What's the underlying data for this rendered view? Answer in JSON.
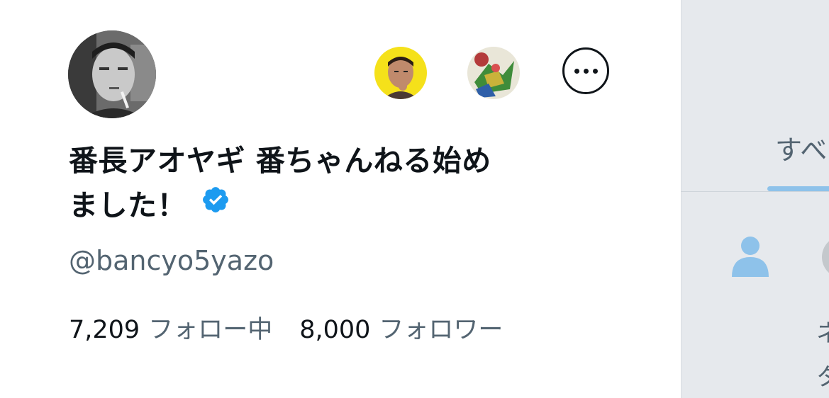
{
  "profile": {
    "display_name_line1": "番長アオヤギ 番ちゃんねる始め",
    "display_name_line2": "ました！",
    "handle": "@bancyo5yazo",
    "following_count": "7,209",
    "following_label": "フォロー中",
    "followers_count": "8,000",
    "followers_label": "フォロワー",
    "verified": true
  },
  "icons": {
    "more": "more-options-icon",
    "verified": "verified-badge-icon",
    "person": "person-icon"
  },
  "right_panel": {
    "tab_label": "すべ",
    "partial_text_1": "ネ",
    "partial_text_2": "タ"
  },
  "colors": {
    "text_primary": "#0f1419",
    "text_secondary": "#536471",
    "verified_blue": "#1d9bf0",
    "tab_indicator": "#8ec2ea",
    "right_panel_bg": "#e6e9ed"
  }
}
